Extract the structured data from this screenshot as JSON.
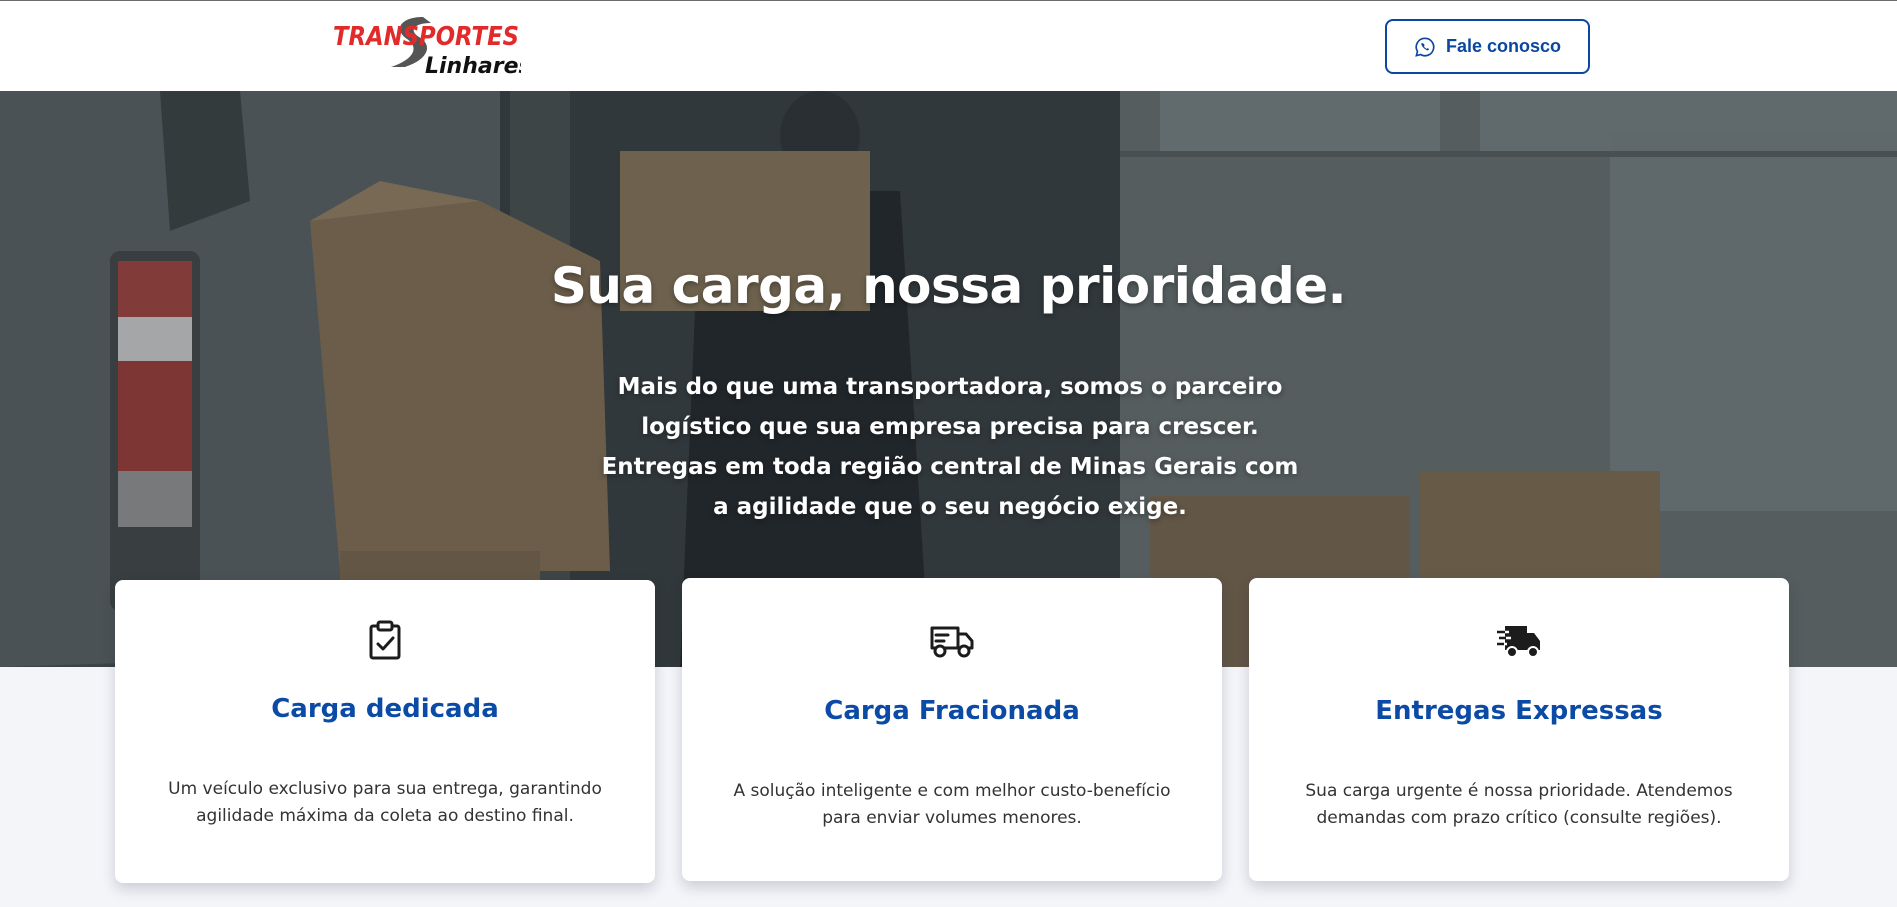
{
  "brand": {
    "logo_line1": "TRANSPORTES",
    "logo_line2": "Linhares",
    "logo_icon": "road-s-logo-icon",
    "primary_color": "#0b47a0",
    "logo_red": "#e22a2a"
  },
  "header": {
    "cta_label": "Fale conosco",
    "cta_icon": "whatsapp-icon"
  },
  "hero": {
    "title": "Sua carga, nossa prioridade.",
    "subtitle": "Mais do que uma transportadora, somos o parceiro logístico que sua empresa precisa para crescer. Entregas em toda região central de Minas Gerais com a agilidade que o seu negócio exige."
  },
  "cards": [
    {
      "icon": "clipboard-check-icon",
      "title": "Carga dedicada",
      "text": "Um veículo exclusivo para sua entrega, garantindo agilidade máxima da coleta ao destino final."
    },
    {
      "icon": "truck-icon",
      "title": "Carga Fracionada",
      "text": "A solução inteligente e com melhor custo-benefício para enviar volumes menores."
    },
    {
      "icon": "fast-truck-icon",
      "title": "Entregas Expressas",
      "text": "Sua carga urgente é nossa prioridade. Atendemos demandas com prazo crítico (consulte regiões)."
    }
  ]
}
